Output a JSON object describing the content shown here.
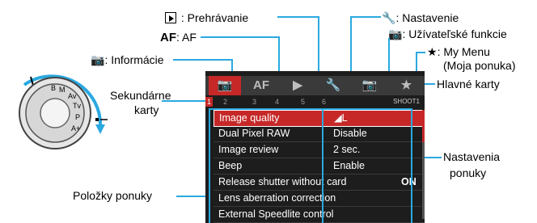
{
  "labels": {
    "playback": "Prehrávanie",
    "af_prefix": "AF",
    "af": "AF",
    "settings": "Nastavenie",
    "custom": "Užívateľské funkcie",
    "mymenu": "My Menu",
    "mymenu_sk": "(Moja ponuka)",
    "info": "Informácie",
    "secondary_1": "Sekundárne",
    "secondary_2": "karty",
    "main_tabs": "Hlavné karty",
    "menu_settings_1": "Nastavenia",
    "menu_settings_2": "ponuky",
    "menu_items": "Položky ponuky"
  },
  "camera": {
    "main_tabs": [
      {
        "icon": "camera-icon",
        "active": true
      },
      {
        "label": "AF",
        "active": false
      },
      {
        "icon": "playback-icon",
        "active": false
      },
      {
        "icon": "wrench-icon",
        "active": false
      },
      {
        "icon": "custom-camera-icon",
        "active": false
      },
      {
        "icon": "star-icon",
        "active": false
      }
    ],
    "sub_tabs": [
      "1",
      "2",
      "3",
      "4",
      "5",
      "6"
    ],
    "shoot_label": "SHOOT1",
    "items": [
      {
        "name": "Image quality",
        "value": "L",
        "selected": true
      },
      {
        "name": "Dual Pixel RAW",
        "value": "Disable"
      },
      {
        "name": "Image review",
        "value": "2 sec."
      },
      {
        "name": "Beep",
        "value": "Enable"
      },
      {
        "name": "Release shutter without card",
        "value": "ON"
      },
      {
        "name": "Lens aberration correction",
        "value": ""
      },
      {
        "name": "External Speedlite control",
        "value": ""
      }
    ]
  },
  "colors": {
    "accent": "#2aa9e0",
    "tab_active": "#c62828"
  }
}
